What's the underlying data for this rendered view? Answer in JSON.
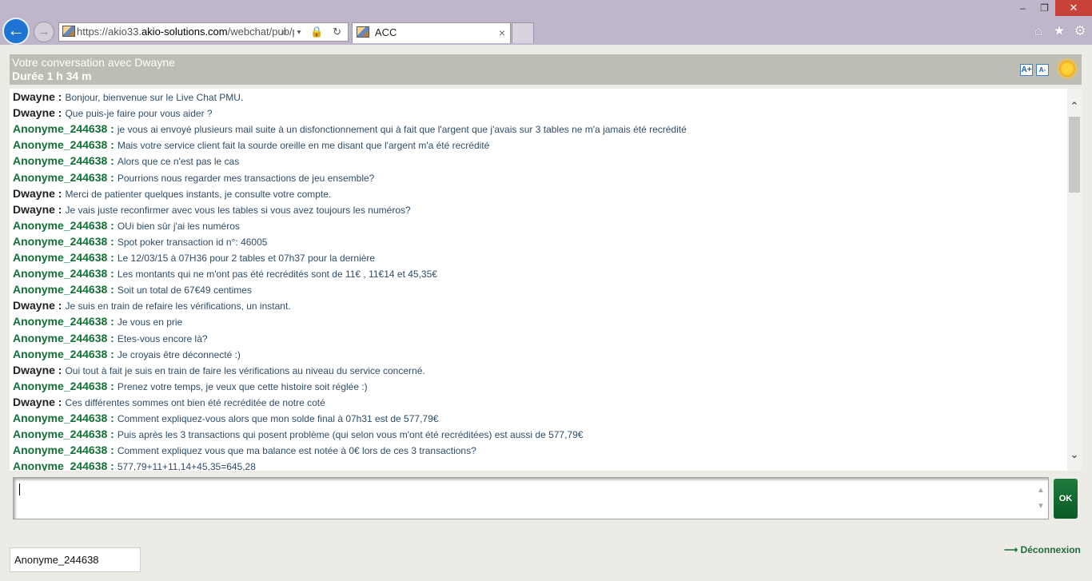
{
  "browser": {
    "url_prefix": "https://akio33.",
    "url_domain": "akio-solutions.com",
    "url_path": "/webchat/pub/pa",
    "tab_title": "ACC",
    "tab_close": "×",
    "back_icon": "←",
    "forward_icon": "→",
    "address_icons": "⌕ ▾ 🔒 ↻",
    "home_icon": "⌂",
    "favorites_icon": "★",
    "settings_icon": "⚙",
    "minimize": "–",
    "restore": "❐",
    "close": "✕"
  },
  "header": {
    "title": "Votre conversation avec Dwayne",
    "duration": "Durée 1 h 34 m",
    "font_increase": "A+",
    "font_decrease": "A-",
    "mood_icon": "sun-icon"
  },
  "messages": [
    {
      "who": "Dwayne :",
      "role": "agent",
      "text": "Bonjour, bienvenue sur le Live Chat PMU."
    },
    {
      "who": "Dwayne :",
      "role": "agent",
      "text": "Que puis-je faire pour vous aider ?"
    },
    {
      "who": "Anonyme_244638 :",
      "role": "user",
      "text": "je vous ai envoyé plusieurs mail suite à un disfonctionnement qui à fait que l'argent que j'avais sur 3 tables ne m'a jamais été recrédité"
    },
    {
      "who": "Anonyme_244638 :",
      "role": "user",
      "text": "Mais votre service client fait la sourde oreille en me disant que l'argent m'a été recrédité"
    },
    {
      "who": "Anonyme_244638 :",
      "role": "user",
      "text": "Alors que ce n'est pas le cas"
    },
    {
      "who": "Anonyme_244638 :",
      "role": "user",
      "text": "Pourrions nous regarder mes transactions de jeu ensemble?"
    },
    {
      "who": "Dwayne :",
      "role": "agent",
      "text": "Merci de patienter quelques instants, je consulte votre compte."
    },
    {
      "who": "Dwayne :",
      "role": "agent",
      "text": "Je vais juste reconfirmer avec vous les tables si vous avez toujours les numéros?"
    },
    {
      "who": "Anonyme_244638 :",
      "role": "user",
      "text": "OUi bien sûr j'ai les numéros"
    },
    {
      "who": "Anonyme_244638 :",
      "role": "user",
      "text": "Spot poker transaction id n°: 46005"
    },
    {
      "who": "Anonyme_244638 :",
      "role": "user",
      "text": "Le 12/03/15 à 07H36 pour 2 tables et 07h37 pour la dernière"
    },
    {
      "who": "Anonyme_244638 :",
      "role": "user",
      "text": "Les montants qui ne m'ont pas été recrédités sont de 11€ , 11€14 et 45,35€"
    },
    {
      "who": "Anonyme_244638 :",
      "role": "user",
      "text": "Soit un total de 67€49 centimes"
    },
    {
      "who": "Dwayne :",
      "role": "agent",
      "text": "Je suis en train de refaire les vérifications, un instant."
    },
    {
      "who": "Anonyme_244638 :",
      "role": "user",
      "text": "Je vous en prie"
    },
    {
      "who": "Anonyme_244638 :",
      "role": "user",
      "text": "Etes-vous encore là?"
    },
    {
      "who": "Anonyme_244638 :",
      "role": "user",
      "text": "Je croyais être déconnecté :)"
    },
    {
      "who": "Dwayne :",
      "role": "agent",
      "text": "Oui tout à fait je suis en train de faire les vérifications au niveau du service concerné."
    },
    {
      "who": "Anonyme_244638 :",
      "role": "user",
      "text": "Prenez votre temps, je veux que cette histoire soit réglée :)"
    },
    {
      "who": "Dwayne :",
      "role": "agent",
      "text": "Ces différentes sommes ont bien été recréditée de notre coté"
    },
    {
      "who": "Anonyme_244638 :",
      "role": "user",
      "text": "Comment expliquez-vous alors que mon solde final à 07h31 est de 577,79€"
    },
    {
      "who": "Anonyme_244638 :",
      "role": "user",
      "text": "Puis après les 3 transactions qui posent problème (qui selon vous m'ont été recréditées) est aussi de 577,79€"
    },
    {
      "who": "Anonyme_244638 :",
      "role": "user",
      "text": "Comment expliquez vous que ma balance est notée à 0€ lors de ces 3 transactions?"
    },
    {
      "who": "Anonyme_244638 :",
      "role": "user",
      "text": "577,79+11+11,14+45,35=645,28"
    }
  ],
  "scroll": {
    "up": "⌃",
    "down": "⌄"
  },
  "composer": {
    "value": "",
    "send_label": "OK",
    "arrows_up": "▲",
    "arrows_down": "▼"
  },
  "footer": {
    "nickname": "Anonyme_244638",
    "logout_label": "⟶ Déconnexion"
  }
}
